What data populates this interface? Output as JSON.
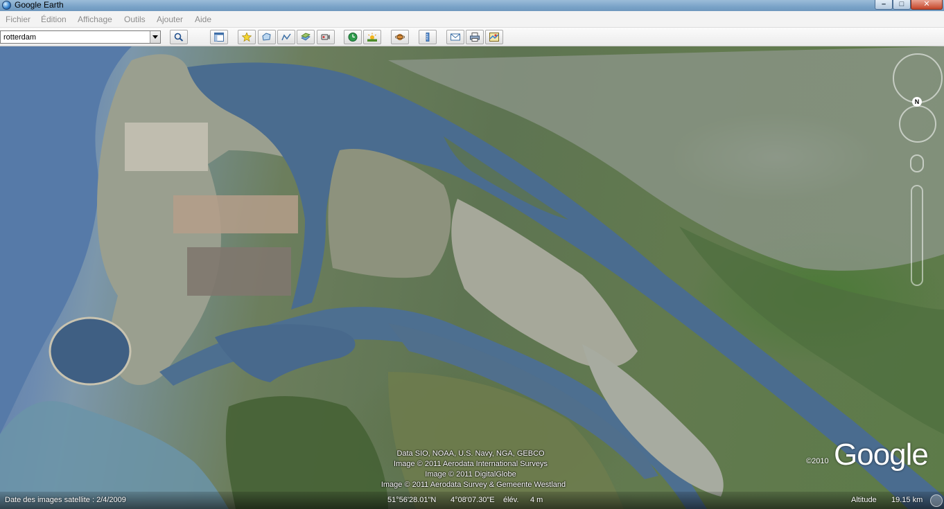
{
  "window": {
    "title": "Google Earth",
    "minimize_glyph": "–",
    "maximize_glyph": "□",
    "close_glyph": "✕"
  },
  "menu": {
    "items": [
      "Fichier",
      "Édition",
      "Affichage",
      "Outils",
      "Ajouter",
      "Aide"
    ]
  },
  "search": {
    "value": "rotterdam"
  },
  "toolbar": {
    "buttons": [
      "sidebar-toggle-icon",
      "placemark-icon",
      "polygon-icon",
      "path-icon",
      "image-overlay-icon",
      "record-tour-icon",
      "historical-imagery-icon",
      "sunlight-icon",
      "planets-icon",
      "ruler-icon",
      "email-icon",
      "print-icon",
      "view-in-maps-icon"
    ]
  },
  "map": {
    "attribution": [
      "Data SIO, NOAA, U.S. Navy, NGA, GEBCO",
      "Image © 2011 Aerodata International Surveys",
      "Image © 2011 DigitalGlobe",
      "Image © 2011 Aerodata Survey & Gemeente Westland"
    ],
    "logo": "Google",
    "logo_year": "©2010",
    "compass_north": "N"
  },
  "status": {
    "imagery_date": "Date des images satellite : 2/4/2009",
    "latitude": "51°56'28.01\"N",
    "longitude": "4°08'07.30\"E",
    "elevation_label": "élév.",
    "elevation_value": "4 m",
    "altitude_label": "Altitude",
    "altitude_value": "19.15 km"
  },
  "colors": {
    "water": "#4f6f95",
    "sea": "#5d7fab",
    "land": "#5f7650",
    "urban": "#a9b1a6"
  }
}
